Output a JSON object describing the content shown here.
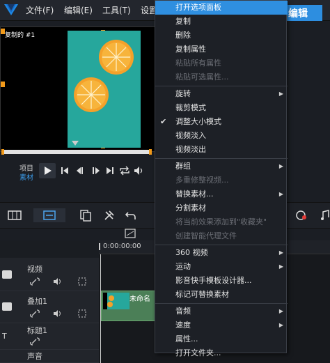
{
  "menubar": {
    "items": [
      "文件(F)",
      "编辑(E)",
      "工具(T)",
      "设置"
    ],
    "edit_tab": "编辑"
  },
  "preview": {
    "label": "复制的 #1"
  },
  "controls": {
    "project_label": "项目",
    "clip_label": "素材"
  },
  "ruler": {
    "time": "0:00:00:00"
  },
  "tracks": [
    {
      "name": "视频"
    },
    {
      "name": "叠加1"
    },
    {
      "name": "标题1"
    },
    {
      "name": "声音"
    }
  ],
  "clip": {
    "title": "未命名"
  },
  "context_menu": {
    "items": [
      {
        "label": "打开选项面板",
        "state": "highlight"
      },
      {
        "label": "复制",
        "state": "normal"
      },
      {
        "label": "删除",
        "state": "normal"
      },
      {
        "label": "复制属性",
        "state": "normal"
      },
      {
        "label": "粘贴所有属性",
        "state": "disabled"
      },
      {
        "label": "粘贴可选属性...",
        "state": "disabled"
      },
      {
        "label": "旋转",
        "state": "normal",
        "submenu": true
      },
      {
        "label": "裁剪模式",
        "state": "normal"
      },
      {
        "label": "调整大小模式",
        "state": "checked"
      },
      {
        "label": "视频淡入",
        "state": "normal"
      },
      {
        "label": "视频淡出",
        "state": "normal"
      },
      {
        "label": "群组",
        "state": "normal",
        "submenu": true
      },
      {
        "label": "多重修整视频...",
        "state": "disabled"
      },
      {
        "label": "替换素材...",
        "state": "normal",
        "submenu": true
      },
      {
        "label": "分割素材",
        "state": "normal"
      },
      {
        "label": "将当前效果添加到\"收藏夹\"",
        "state": "disabled"
      },
      {
        "label": "创建智能代理文件",
        "state": "disabled"
      },
      {
        "label": "360 视频",
        "state": "normal",
        "submenu": true
      },
      {
        "label": "运动",
        "state": "normal",
        "submenu": true
      },
      {
        "label": "影音快手模板设计器...",
        "state": "normal"
      },
      {
        "label": "标记可替换素材",
        "state": "normal"
      },
      {
        "label": "音频",
        "state": "normal",
        "submenu": true
      },
      {
        "label": "速度",
        "state": "normal",
        "submenu": true
      },
      {
        "label": "属性...",
        "state": "normal"
      },
      {
        "label": "打开文件夹...",
        "state": "normal"
      }
    ]
  },
  "colors": {
    "accent": "#2f8fe0",
    "orange_handle": "#f29a1a",
    "photo_bg": "#26a79c"
  }
}
